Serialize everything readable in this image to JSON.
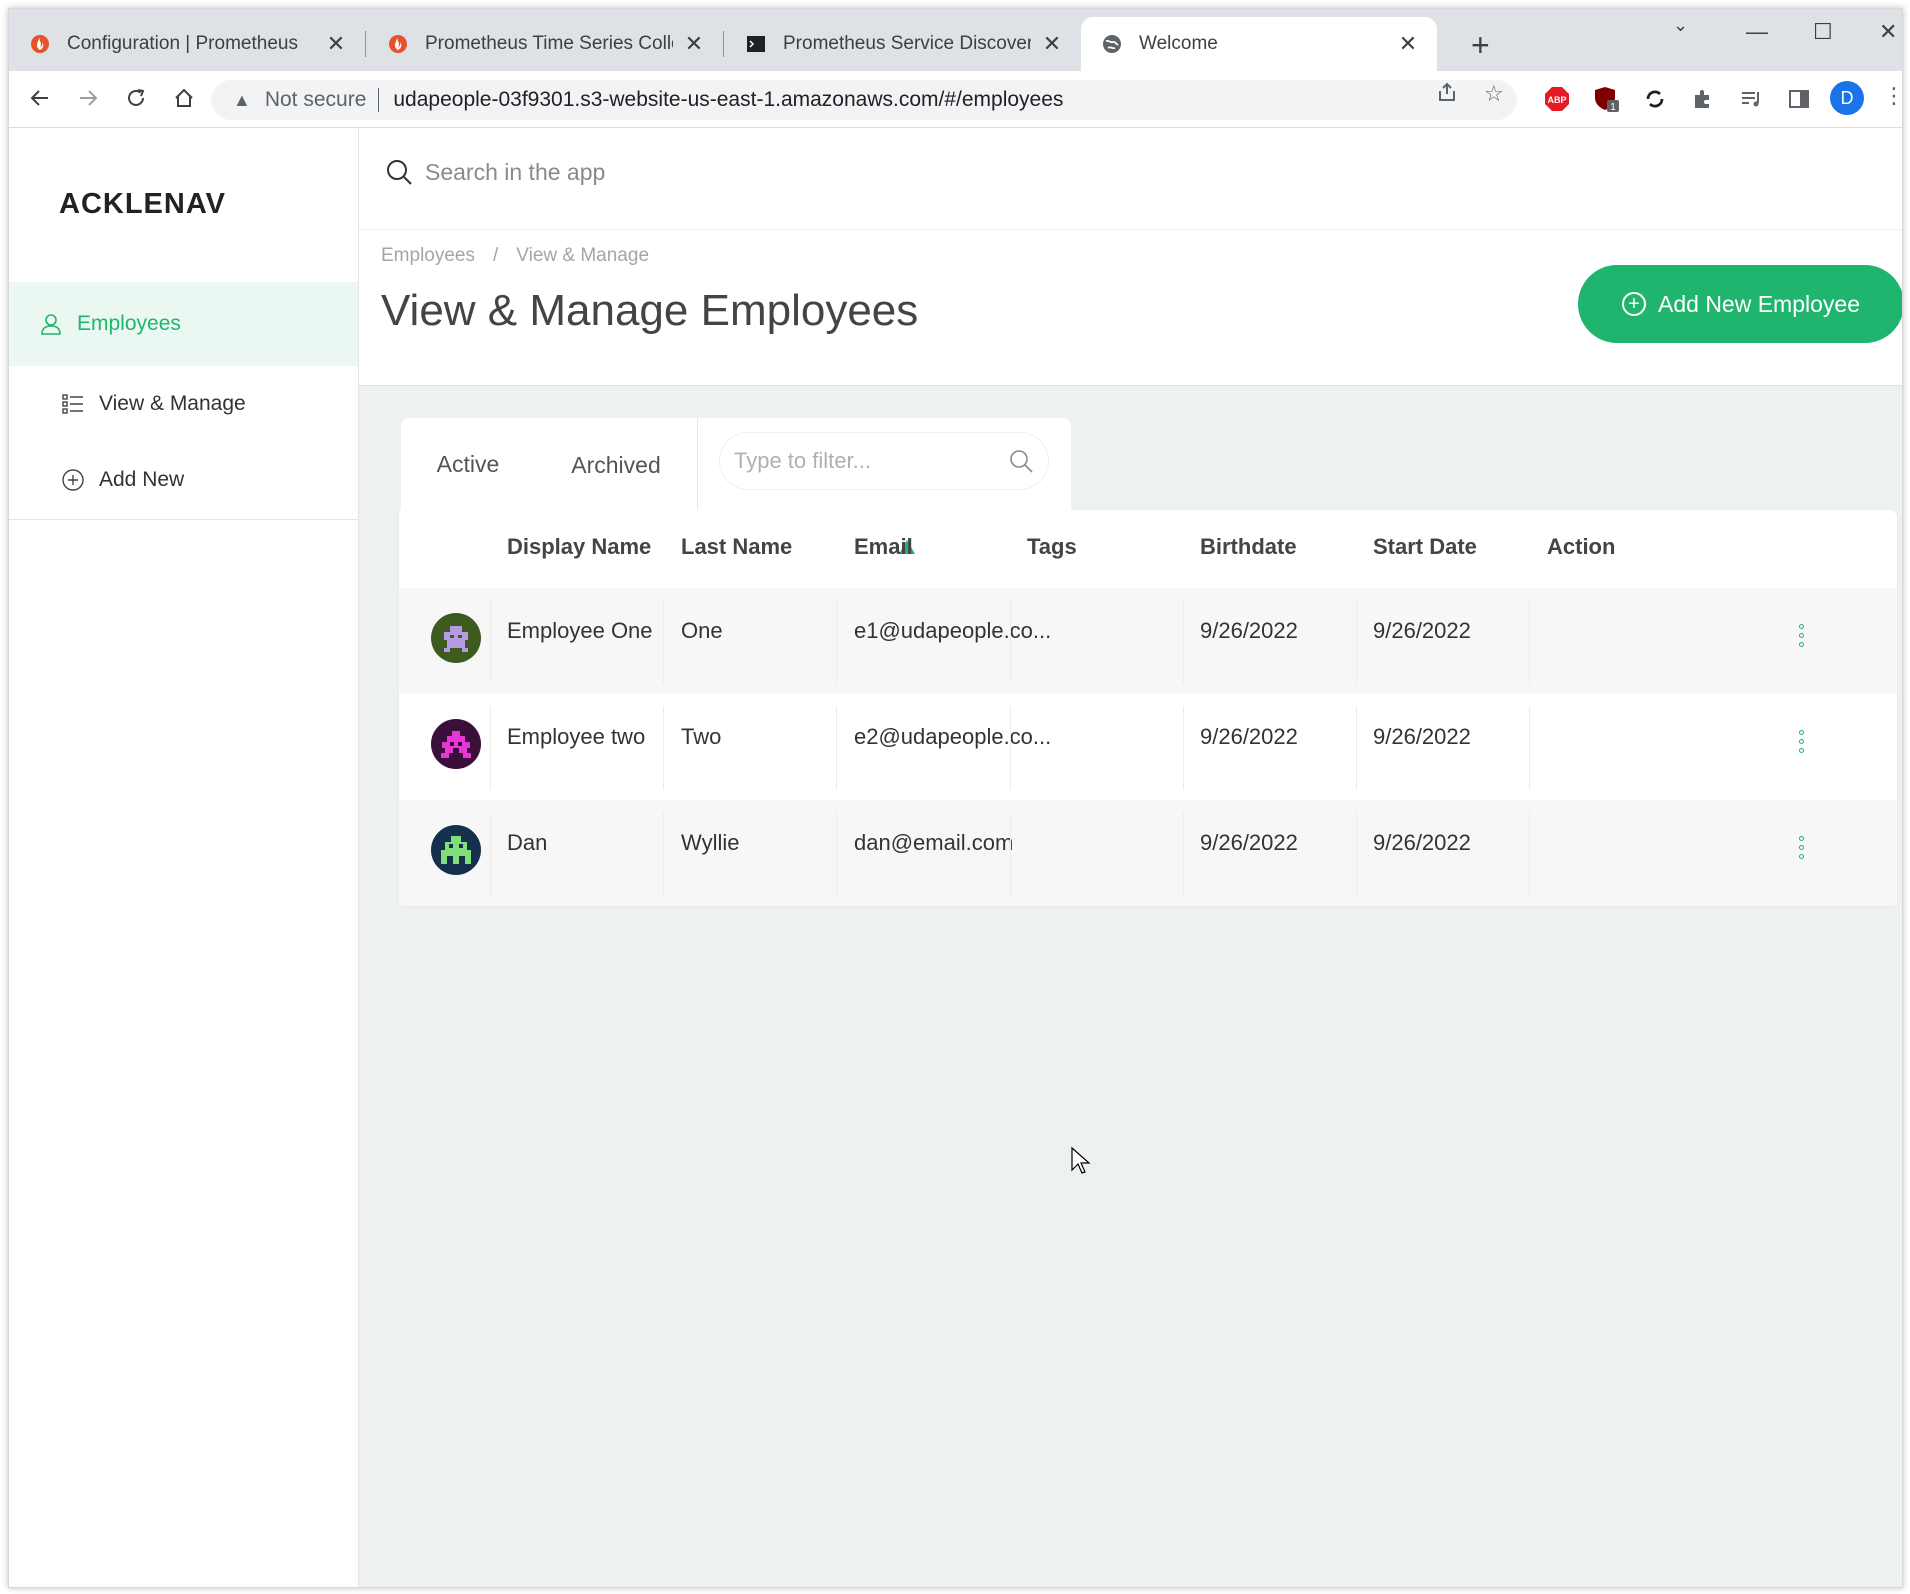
{
  "browser": {
    "tabs": [
      {
        "title": "Configuration | Prometheus",
        "icon": "prometheus-icon"
      },
      {
        "title": "Prometheus Time Series Collectic",
        "icon": "prometheus-icon"
      },
      {
        "title": "Prometheus Service Discovery on",
        "icon": "terminal-icon"
      },
      {
        "title": "Welcome",
        "icon": "globe-icon",
        "active": true
      }
    ],
    "security_label": "Not secure",
    "url": "udapeople-03f9301.s3-website-us-east-1.amazonaws.com/#/employees",
    "profile_initial": "D",
    "extensions": [
      "abp-icon",
      "ublock-icon",
      "sync-icon",
      "puzzle-icon",
      "playlist-icon",
      "sidepanel-icon"
    ],
    "ublock_badge": "1",
    "abp_label": "ABP"
  },
  "app": {
    "logo": "ACKLENAV",
    "search_placeholder": "Search in the app",
    "sidebar": {
      "items": [
        {
          "label": "Employees",
          "icon": "user-icon",
          "active": true
        },
        {
          "label": "View & Manage",
          "icon": "list-icon"
        },
        {
          "label": "Add New",
          "icon": "plus-circle-icon"
        }
      ]
    },
    "breadcrumb": [
      "Employees",
      "/",
      "View & Manage"
    ],
    "page_title": "View & Manage Employees",
    "add_button": "Add New Employee",
    "tabs": [
      "Active",
      "Archived"
    ],
    "filter_placeholder": "Type to filter...",
    "columns": [
      "Display Name",
      "Last Name",
      "Email",
      "Tags",
      "Birthdate",
      "Start Date",
      "Action"
    ],
    "rows": [
      {
        "display_name": "Employee One",
        "last_name": "One",
        "email": "e1@udapeople.co...",
        "tags": "",
        "birthdate": "9/26/2022",
        "start_date": "9/26/2022",
        "avatar_bg": "#3d5a1f",
        "avatar_fg": "#b49be6"
      },
      {
        "display_name": "Employee two",
        "last_name": "Two",
        "email": "e2@udapeople.co...",
        "tags": "",
        "birthdate": "9/26/2022",
        "start_date": "9/26/2022",
        "avatar_bg": "#3a0f3a",
        "avatar_fg": "#e636d6"
      },
      {
        "display_name": "Dan",
        "last_name": "Wyllie",
        "email": "dan@email.com",
        "tags": "",
        "birthdate": "9/26/2022",
        "start_date": "9/26/2022",
        "avatar_bg": "#14304d",
        "avatar_fg": "#7fe07a"
      }
    ],
    "accent_color": "#1fb56e"
  }
}
